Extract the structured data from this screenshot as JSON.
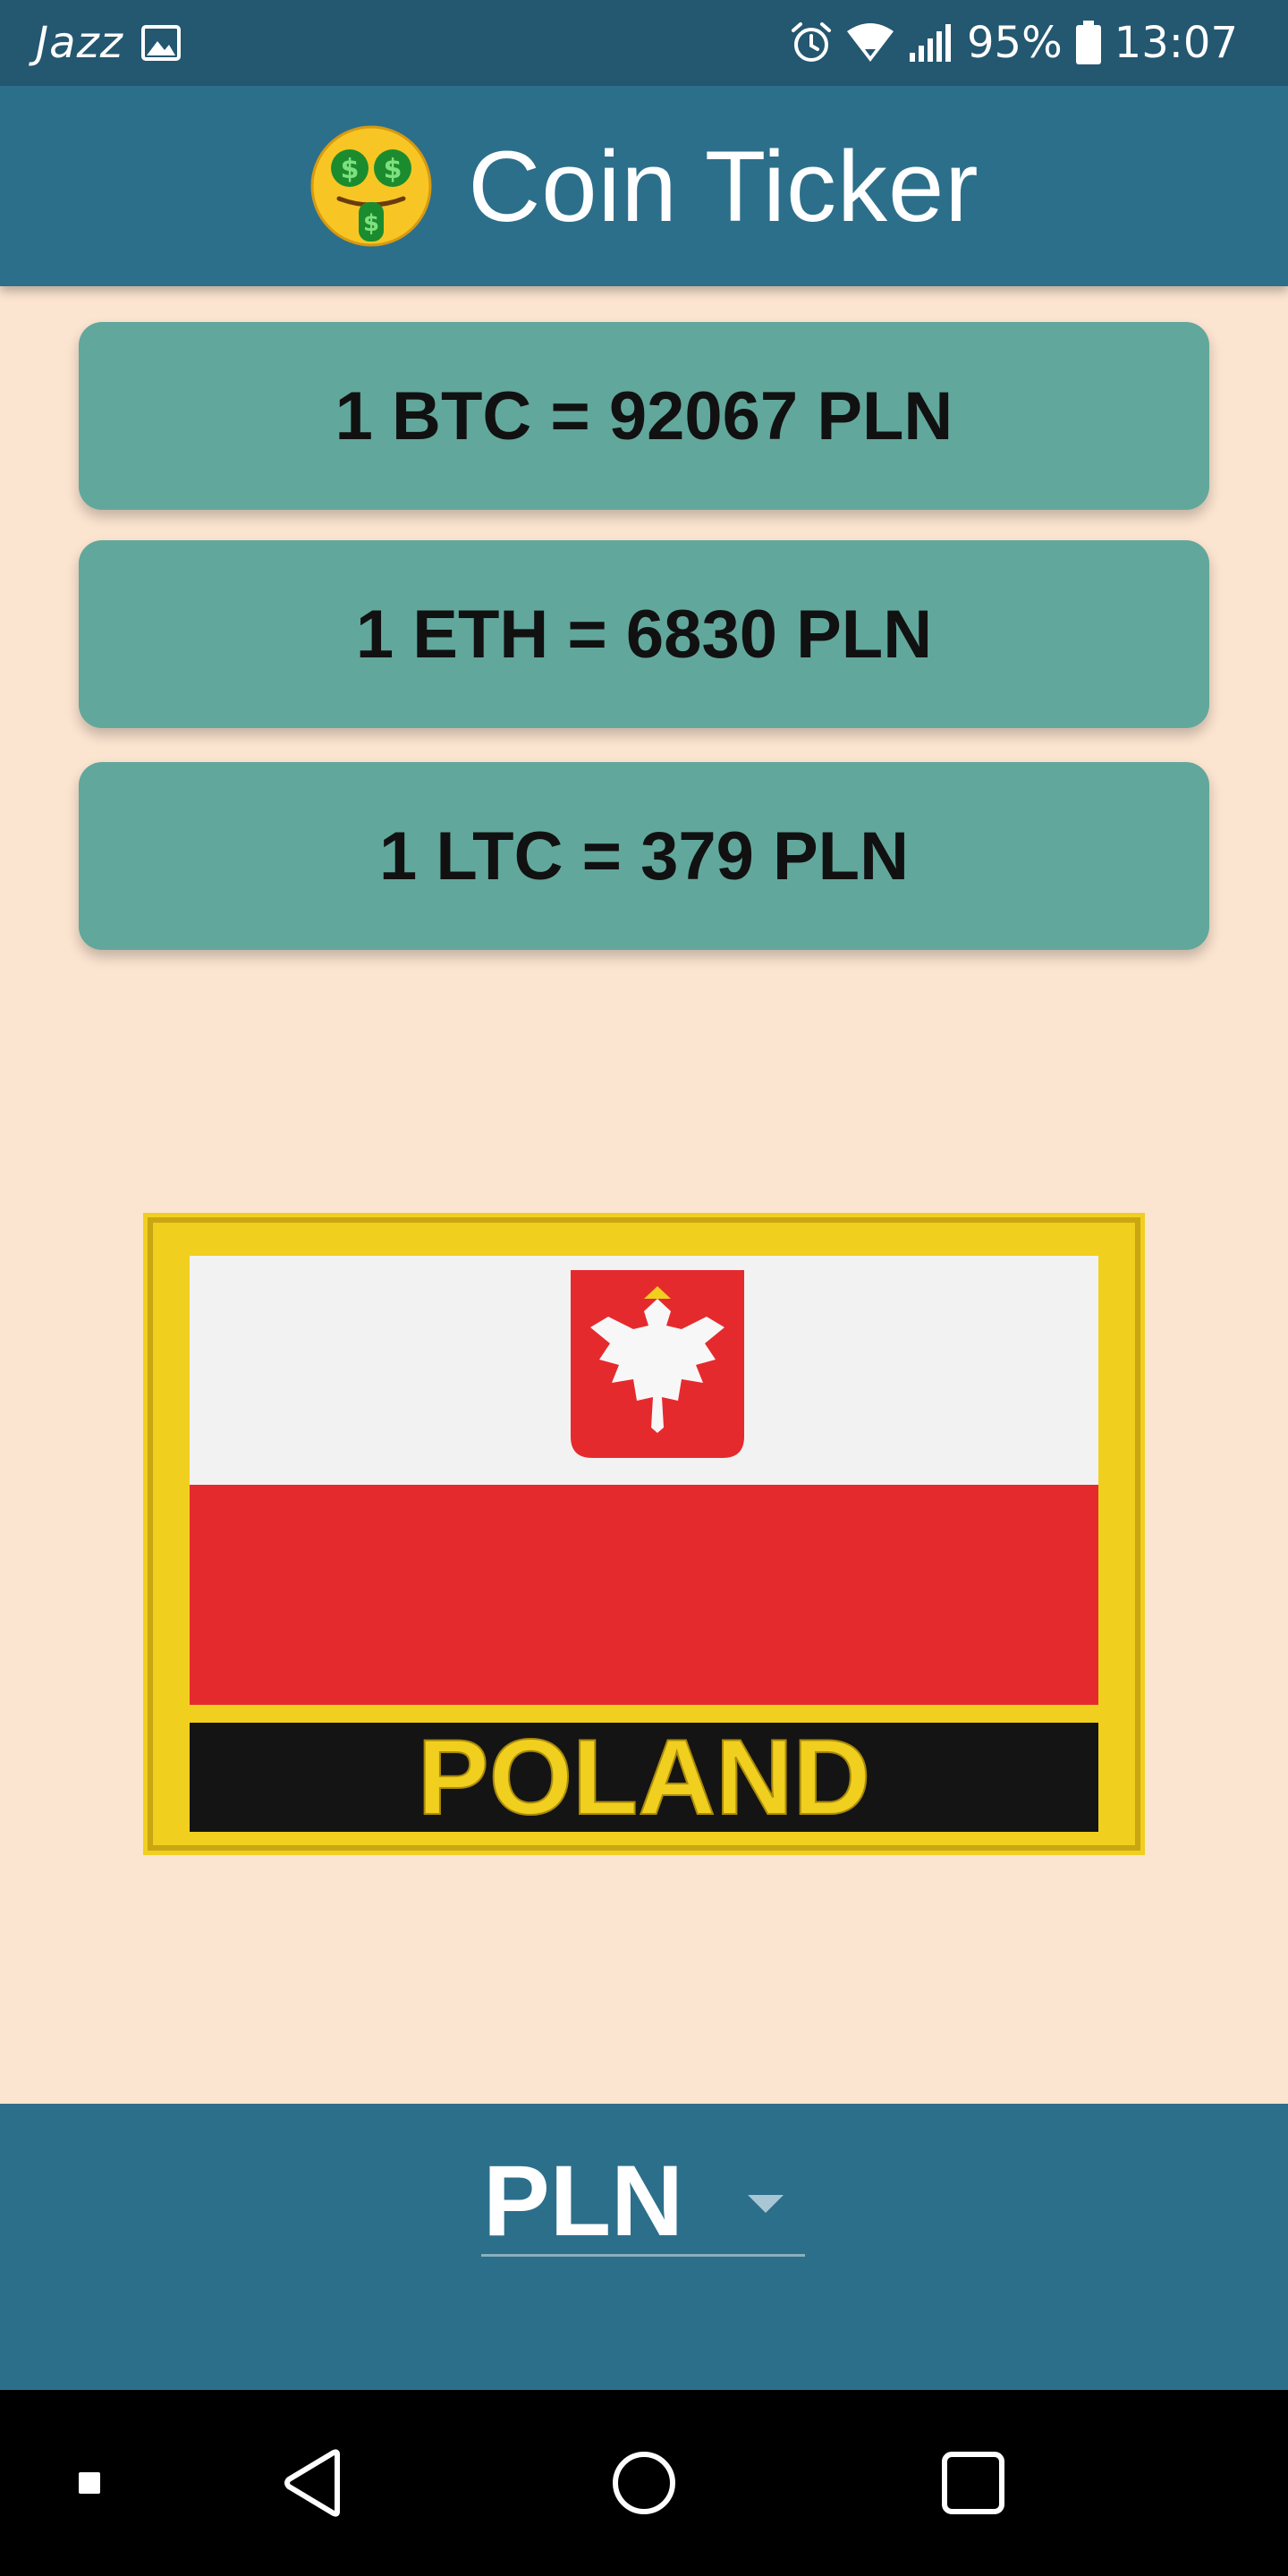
{
  "status_bar": {
    "carrier": "Jazz",
    "battery": "95%",
    "time": "13:07",
    "icons": [
      "gallery-icon",
      "alarm-icon",
      "wifi-icon",
      "signal-icon",
      "battery-icon"
    ]
  },
  "app_bar": {
    "icon": "money-mouth-face-icon",
    "title": "Coin Ticker"
  },
  "rates": [
    {
      "label": "1 BTC = 92067 PLN"
    },
    {
      "label": "1 ETH = 6830 PLN"
    },
    {
      "label": "1 LTC = 379 PLN"
    }
  ],
  "flag": {
    "country_text": "POLAND",
    "colors": {
      "white": "#f2f2f2",
      "red": "#e52a2e",
      "black": "#141414",
      "gold": "#f1cf1e"
    }
  },
  "currency_picker": {
    "selected": "PLN"
  },
  "nav_bar": {
    "buttons": [
      "recent-apps-dot-button",
      "back-button",
      "home-button",
      "overview-button"
    ]
  },
  "colors": {
    "status_bar": "#245770",
    "app_bar": "#2c6f8b",
    "background": "#fbe4d0",
    "card": "#62a79c",
    "picker_area": "#2c6f8b"
  }
}
